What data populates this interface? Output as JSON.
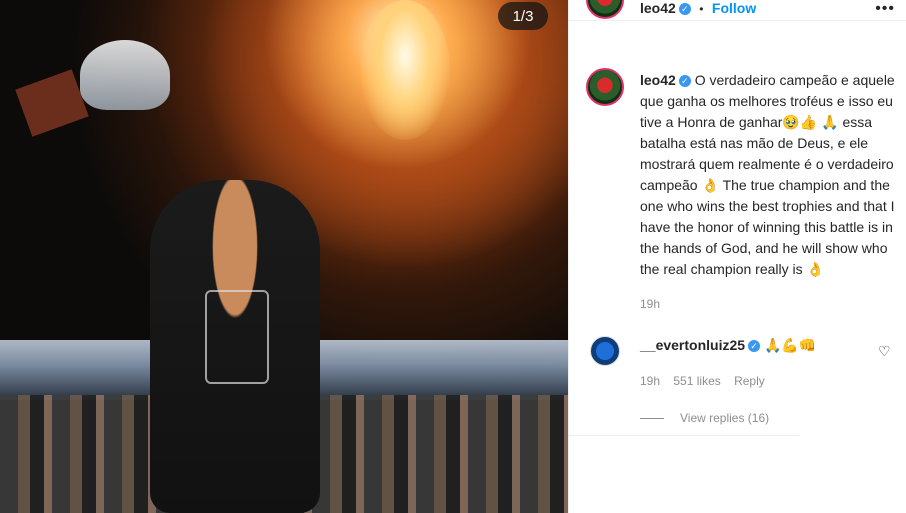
{
  "post": {
    "image_counter": "1/3"
  },
  "header": {
    "username": "leo42",
    "separator": "•",
    "follow_label": "Follow",
    "more_icon": "more-dots-icon"
  },
  "caption": {
    "username": "leo42",
    "text_pt": "O verdadeiro campeão e aquele que ganha os melhores troféus e isso eu tive a Honra de ganhar🥹👍 🙏 essa batalha está nas mão de Deus, e ele mostrará quem realmente é o verdadeiro campeão 👌 ",
    "text_en": "The true champion and the one who wins the best trophies and that I have the honor of winning this battle is in the hands of God, and he will show who the real champion really is 👌",
    "time": "19h"
  },
  "comment": {
    "username": "__evertonluiz25",
    "text": " 🙏💪👊",
    "time": "19h",
    "likes": "551 likes",
    "reply_label": "Reply",
    "view_replies": "View replies (16)"
  }
}
